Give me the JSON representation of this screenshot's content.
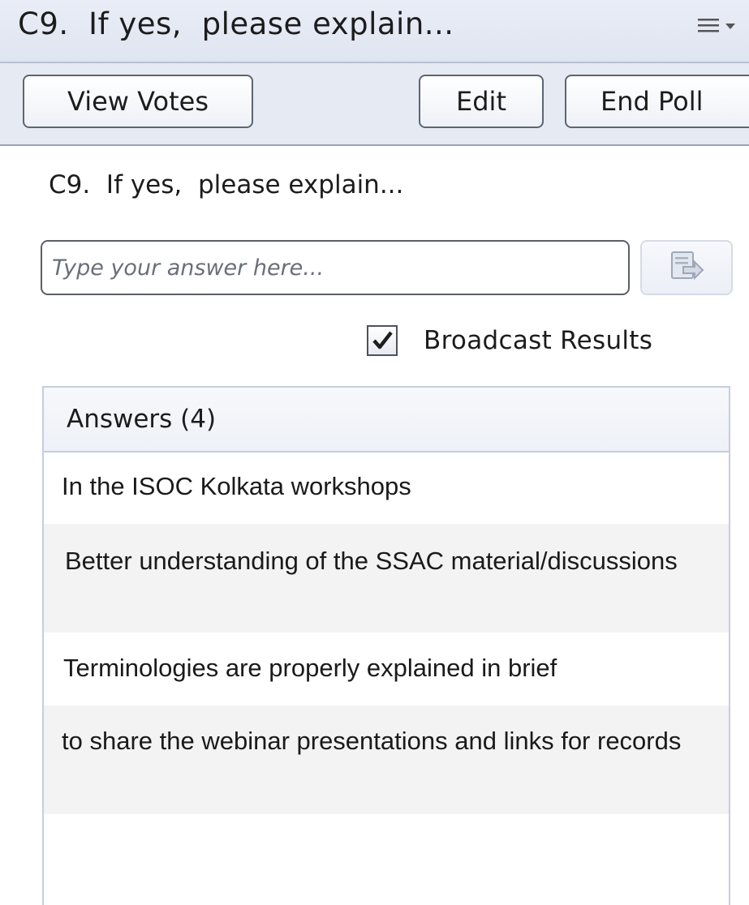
{
  "header": {
    "title": "C9.  If yes,  please explain...",
    "menu_icon": "hamburger-dropdown-icon"
  },
  "toolbar": {
    "view_votes_label": "View Votes",
    "edit_label": "Edit",
    "end_poll_label": "End Poll"
  },
  "question": {
    "text": "C9.  If yes,  please explain..."
  },
  "answer_input": {
    "value": "",
    "placeholder": "Type your answer here...",
    "submit_icon": "submit-answer-icon"
  },
  "broadcast": {
    "label": "Broadcast Results",
    "checked": true
  },
  "answers": {
    "header": "Answers (4)",
    "items": [
      "In the ISOC Kolkata workshops",
      "Better understanding of the SSAC material/discussions",
      "Terminologies are properly explained in brief",
      "to share the webinar presentations and links for records"
    ]
  },
  "colors": {
    "header_bg": "#e6eaf3",
    "alt_row_bg": "#f3f3f3",
    "panel_border": "#c5cde0"
  }
}
